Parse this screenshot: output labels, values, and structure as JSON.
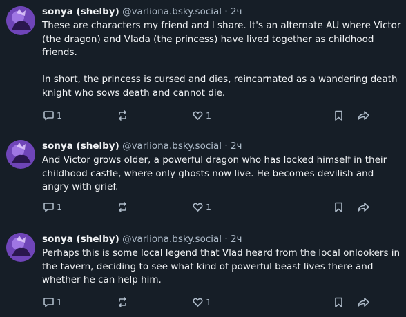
{
  "posts": [
    {
      "author": "sonya (shelby)",
      "handle": "@varliona.bsky.social",
      "separator": "·",
      "time": "2ч",
      "paragraphs": [
        "These are characters my friend and I share. It's an alternate AU where Victor (the dragon) and Vlada (the princess) have lived together as childhood friends.",
        "In short, the princess is cursed and dies, reincarnated as a wandering death knight who sows death and cannot die."
      ],
      "reply_count": "1",
      "like_count": "1"
    },
    {
      "author": "sonya (shelby)",
      "handle": "@varliona.bsky.social",
      "separator": "·",
      "time": "2ч",
      "paragraphs": [
        "And Victor grows older, a powerful dragon who has locked himself in their childhood castle, where only ghosts now live. He becomes devilish and angry with grief."
      ],
      "reply_count": "1",
      "like_count": "1"
    },
    {
      "author": "sonya (shelby)",
      "handle": "@varliona.bsky.social",
      "separator": "·",
      "time": "2ч",
      "paragraphs": [
        "Perhaps this is some local legend that Vlad heard from the local onlookers in the tavern, deciding to see what kind of powerful beast lives there and whether he can help him."
      ],
      "reply_count": "1",
      "like_count": "1"
    }
  ],
  "icons": {
    "reply": "speech-bubble-icon",
    "repost": "repost-arrows-icon",
    "like": "heart-icon",
    "bookmark": "bookmark-icon",
    "share": "share-arrow-icon"
  },
  "colors": {
    "background": "#161e27",
    "text": "#f1f3f5",
    "muted": "#aebbc9",
    "divider": "#2e4052"
  }
}
